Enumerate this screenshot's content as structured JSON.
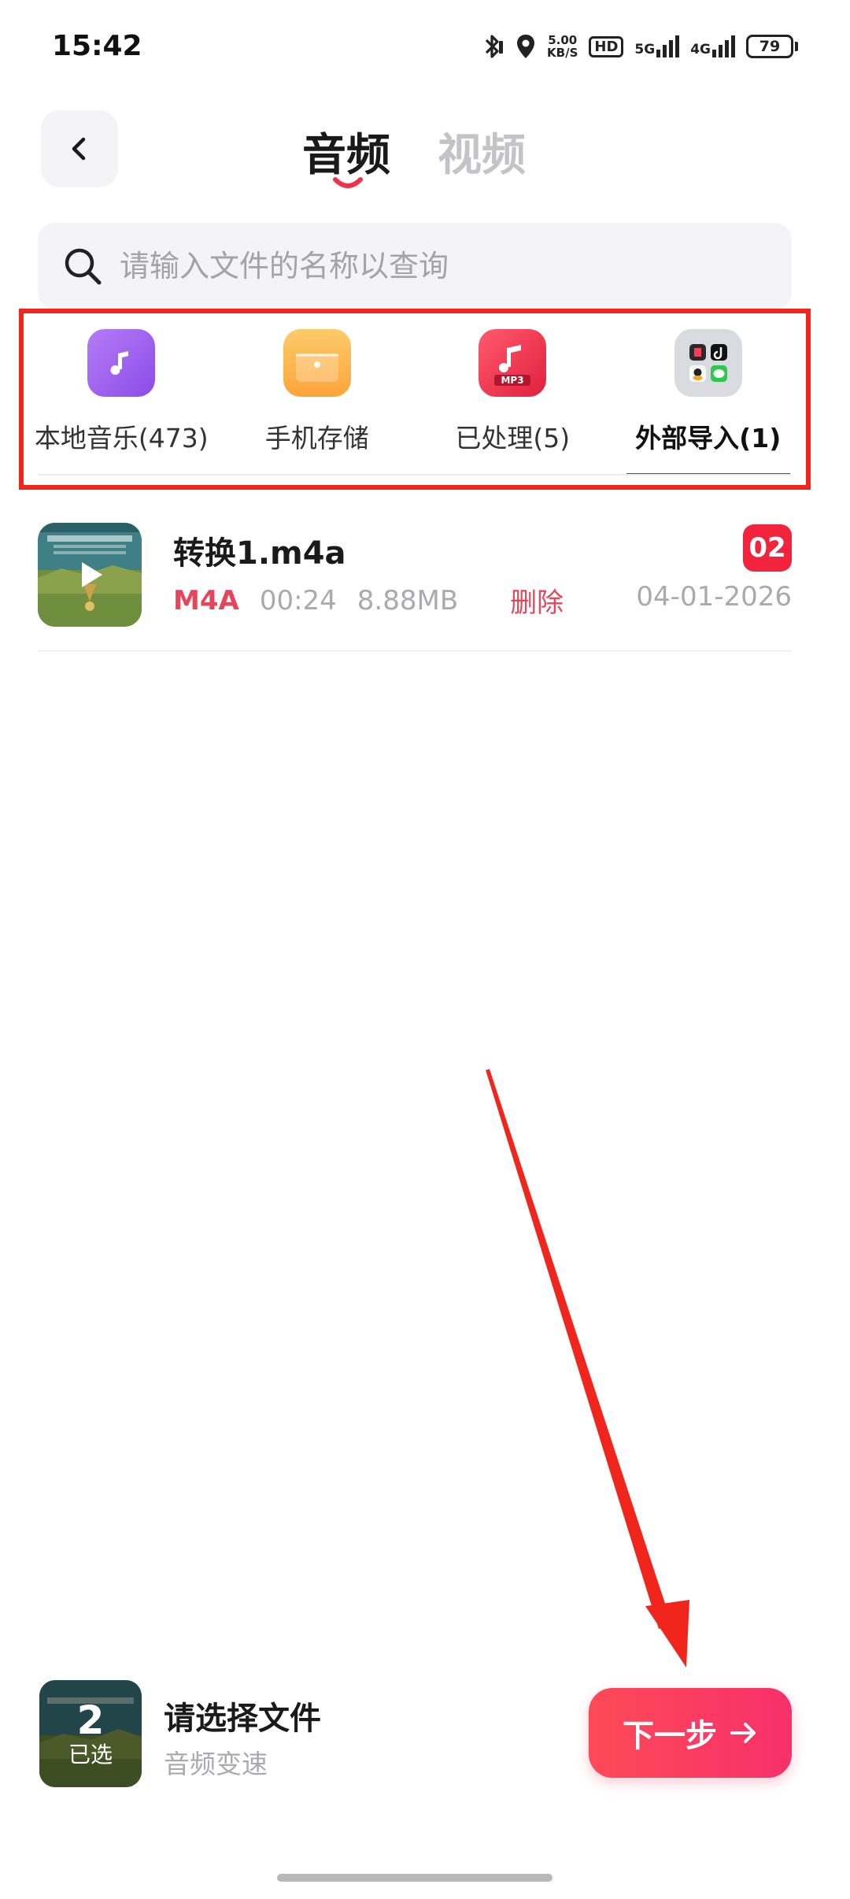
{
  "status_bar": {
    "time": "15:42",
    "net_speed_value": "5.00",
    "net_speed_unit": "KB/S",
    "hd_label": "HD",
    "sim1_label": "5G",
    "sim2_label": "4G",
    "battery_level": "79"
  },
  "header": {
    "back_icon": "chevron-left-icon",
    "tabs": [
      {
        "label": "音频",
        "active": true
      },
      {
        "label": "视频",
        "active": false
      }
    ]
  },
  "search": {
    "icon": "search-icon",
    "placeholder": "请输入文件的名称以查询",
    "value": ""
  },
  "sources": [
    {
      "label": "本地音乐(473)",
      "icon": "music-note-icon",
      "color": "#a066f0",
      "active": false
    },
    {
      "label": "手机存储",
      "icon": "storage-icon",
      "color": "#fdb04a",
      "active": false
    },
    {
      "label": "已处理(5)",
      "icon": "mp3-icon",
      "color": "#f2304a",
      "icon_text": "MP3",
      "active": false
    },
    {
      "label": "外部导入(1)",
      "icon": "apps-folder-icon",
      "color": "#d6d8de",
      "active": true
    }
  ],
  "files": [
    {
      "name": "转换1.m4a",
      "format": "M4A",
      "duration": "00:24",
      "size": "8.88MB",
      "delete_label": "删除",
      "order_badge": "02",
      "date": "04-01-2026"
    }
  ],
  "bottom_bar": {
    "selected_count": "2",
    "selected_label": "已选",
    "title": "请选择文件",
    "subtitle": "音频变速",
    "next_label": "下一步"
  },
  "colors": {
    "accent": "#f6306b",
    "annotation": "#f0261c"
  }
}
